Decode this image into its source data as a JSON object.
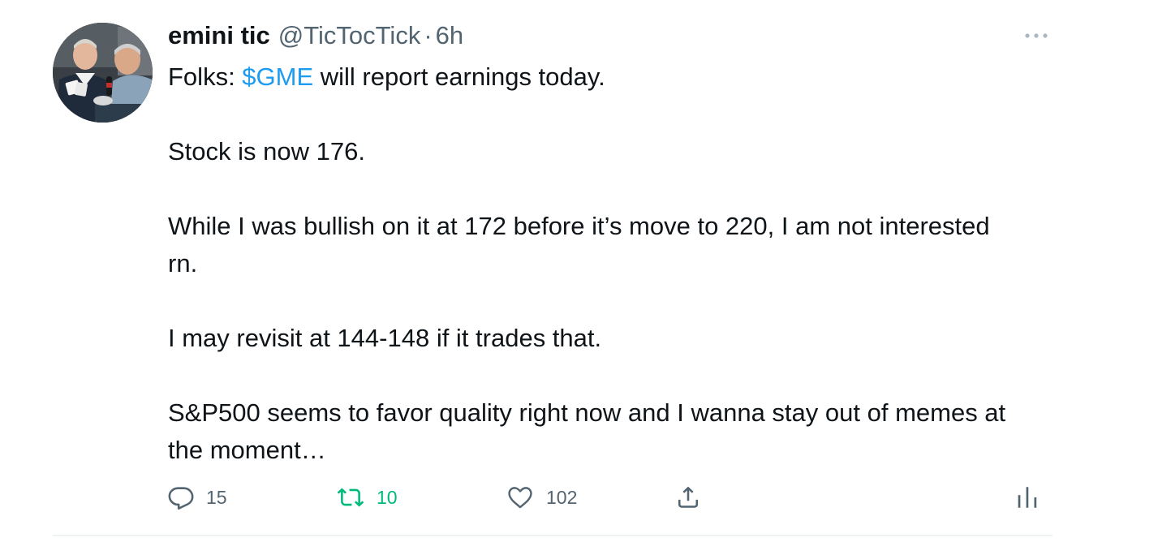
{
  "author": {
    "display_name": "emini tic",
    "handle": "@TicTocTick",
    "separator": "·",
    "time": "6h",
    "avatar_icon": "avatar-photo"
  },
  "tweet": {
    "line1_prefix": "Folks: ",
    "cashtag": "$GME",
    "line1_suffix": " will report earnings today.",
    "p2": "Stock is now 176.",
    "p3": "While I was bullish on it at 172 before it’s move to 220, I am not interested rn.",
    "p4": "I may revisit at 144-148 if it trades that.",
    "p5": "S&P500 seems to favor quality right now and I wanna stay out of memes at the moment…"
  },
  "actions": {
    "reply_count": "15",
    "retweet_count": "10",
    "like_count": "102",
    "reply_icon": "reply-icon",
    "retweet_icon": "retweet-icon",
    "like_icon": "heart-icon",
    "share_icon": "share-icon",
    "analytics_icon": "analytics-icon",
    "more_icon": "more-icon"
  },
  "colors": {
    "text": "#0f1419",
    "secondary": "#536471",
    "link": "#1d9bf0",
    "retweet": "#00ba7c",
    "divider": "#eff3f4"
  }
}
